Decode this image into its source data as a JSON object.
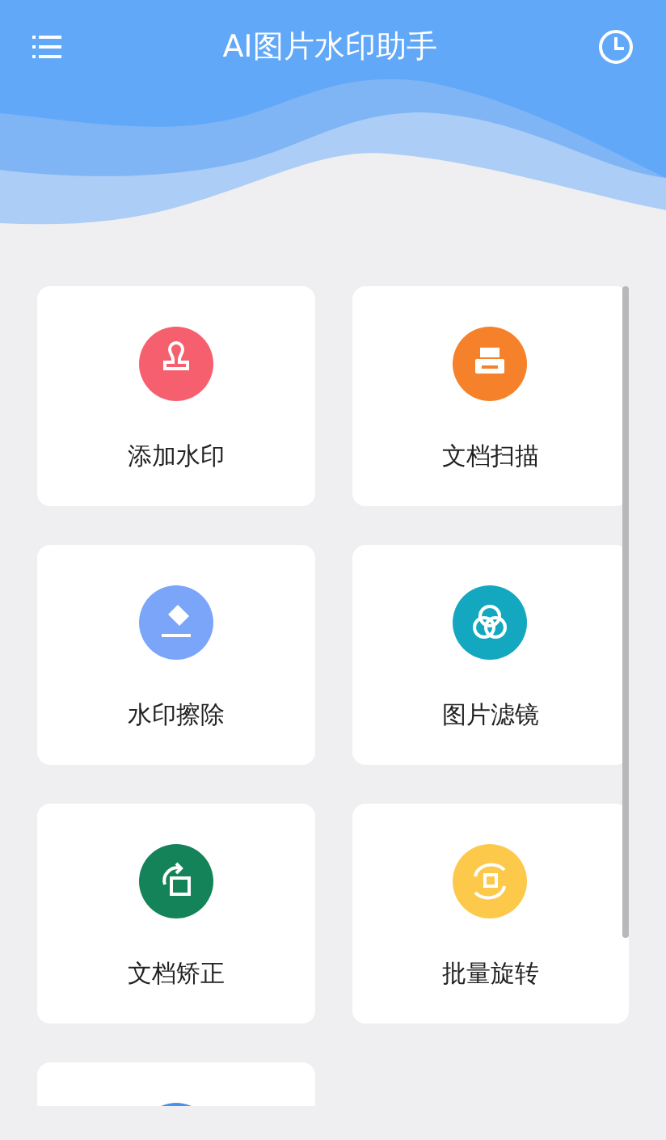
{
  "app_bar": {
    "title": "AI图片水印助手"
  },
  "cards": [
    {
      "kind": "stamp",
      "label": "添加水印",
      "color": "#f55f6e"
    },
    {
      "kind": "printer",
      "label": "文档扫描",
      "color": "#f5822a"
    },
    {
      "kind": "eraser",
      "label": "水印擦除",
      "color": "#7aa5f9"
    },
    {
      "kind": "circles",
      "label": "图片滤镜",
      "color": "#13a8bf"
    },
    {
      "kind": "rotate-frame",
      "label": "文档矫正",
      "color": "#148359"
    },
    {
      "kind": "rotate-sync",
      "label": "批量旋转",
      "color": "#fdc94b"
    },
    {
      "kind": "partial",
      "color": "#4a8ff0"
    }
  ]
}
